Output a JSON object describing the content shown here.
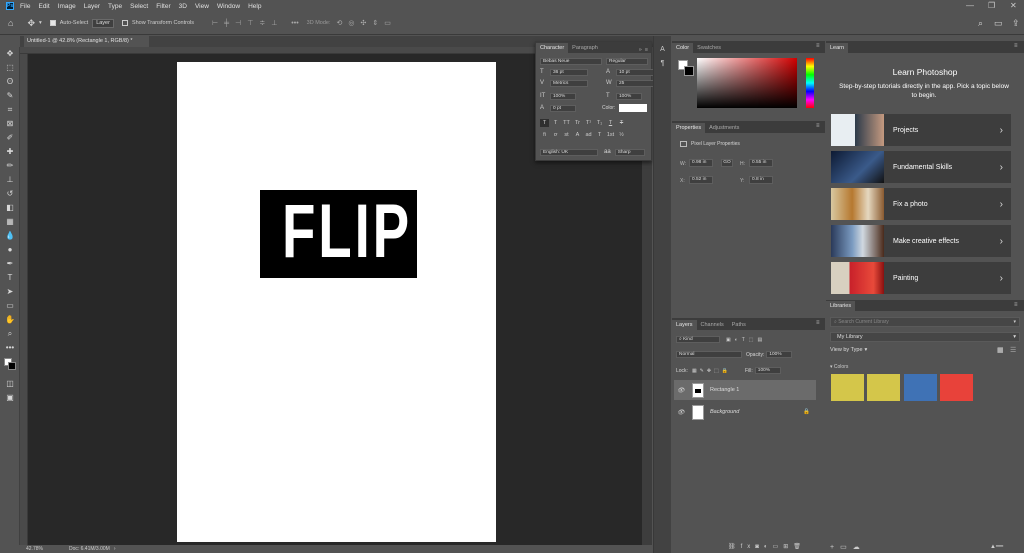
{
  "menubar": {
    "items": [
      "File",
      "Edit",
      "Image",
      "Layer",
      "Type",
      "Select",
      "Filter",
      "3D",
      "View",
      "Window",
      "Help"
    ]
  },
  "options": {
    "auto_select": "Auto-Select",
    "layer_select": "Layer",
    "transform_controls": "Show Transform Controls",
    "mode_3d": "3D Mode:"
  },
  "document": {
    "tab_title": "Untitled-1 @ 42.8% (Rectangle 1, RGB/8) *",
    "canvas_text": "FLIP",
    "zoom": "42.78%",
    "doc_size": "Doc: 6.41M/3.00M"
  },
  "character": {
    "tab_character": "Character",
    "tab_paragraph": "Paragraph",
    "font_family": "Bebas Neue",
    "font_style": "Regular",
    "font_size": "36 pt",
    "leading": "10 pt",
    "kerning": "Metrics",
    "tracking": "25",
    "vertical_scale": "100%",
    "horizontal_scale": "100%",
    "baseline": "0 pt",
    "color_label": "Color:",
    "language": "English: UK",
    "antialias": "Sharp",
    "format_buttons": [
      "T",
      "T",
      "TT",
      "Tr",
      "T¹",
      "T₁",
      "T",
      "T"
    ],
    "opentype_buttons": [
      "fi",
      "ơ",
      "st",
      "A",
      "ad",
      "T",
      "1st",
      "½"
    ]
  },
  "color_panel": {
    "tab_color": "Color",
    "tab_swatches": "Swatches"
  },
  "properties": {
    "tab_properties": "Properties",
    "tab_adjustments": "Adjustments",
    "section": "Pixel Layer Properties",
    "w_label": "W:",
    "w_value": "0.98 in",
    "h_label": "H:",
    "h_value": "0.55 in",
    "x_label": "X:",
    "x_value": "0.52 in",
    "y_label": "Y:",
    "y_value": "0.8 in",
    "link": "GO"
  },
  "layers": {
    "tabs": [
      "Layers",
      "Channels",
      "Paths"
    ],
    "filter_kind": "Kind",
    "blend_mode": "Normal",
    "opacity_label": "Opacity:",
    "opacity_value": "100%",
    "lock_label": "Lock:",
    "fill_label": "Fill:",
    "fill_value": "100%",
    "items": [
      {
        "name": "Rectangle 1",
        "selected": true
      },
      {
        "name": "Background",
        "selected": false
      }
    ]
  },
  "learn": {
    "tab": "Learn",
    "title": "Learn Photoshop",
    "subtitle": "Step-by-step tutorials directly in the app. Pick a topic below to begin.",
    "cards": [
      {
        "label": "Projects",
        "thumb_color": "#2b6ea8"
      },
      {
        "label": "Fundamental Skills",
        "thumb_color": "#1c2a4a"
      },
      {
        "label": "Fix a photo",
        "thumb_color": "#a8743a"
      },
      {
        "label": "Make creative effects",
        "thumb_color": "#4a6a9a"
      },
      {
        "label": "Painting",
        "thumb_color": "#c63a2a"
      }
    ]
  },
  "libraries": {
    "tab": "Libraries",
    "search_placeholder": "Search Current Library",
    "library_name": "My Library",
    "view_by": "View by Type",
    "section_colors": "Colors",
    "swatches": [
      "#d4c64a",
      "#d4c64a",
      "#3f72b5",
      "#e8423a"
    ]
  },
  "colors": {
    "accent_blue": "#31a8ff",
    "panel_bg": "#535353",
    "pasteboard": "#282828"
  }
}
